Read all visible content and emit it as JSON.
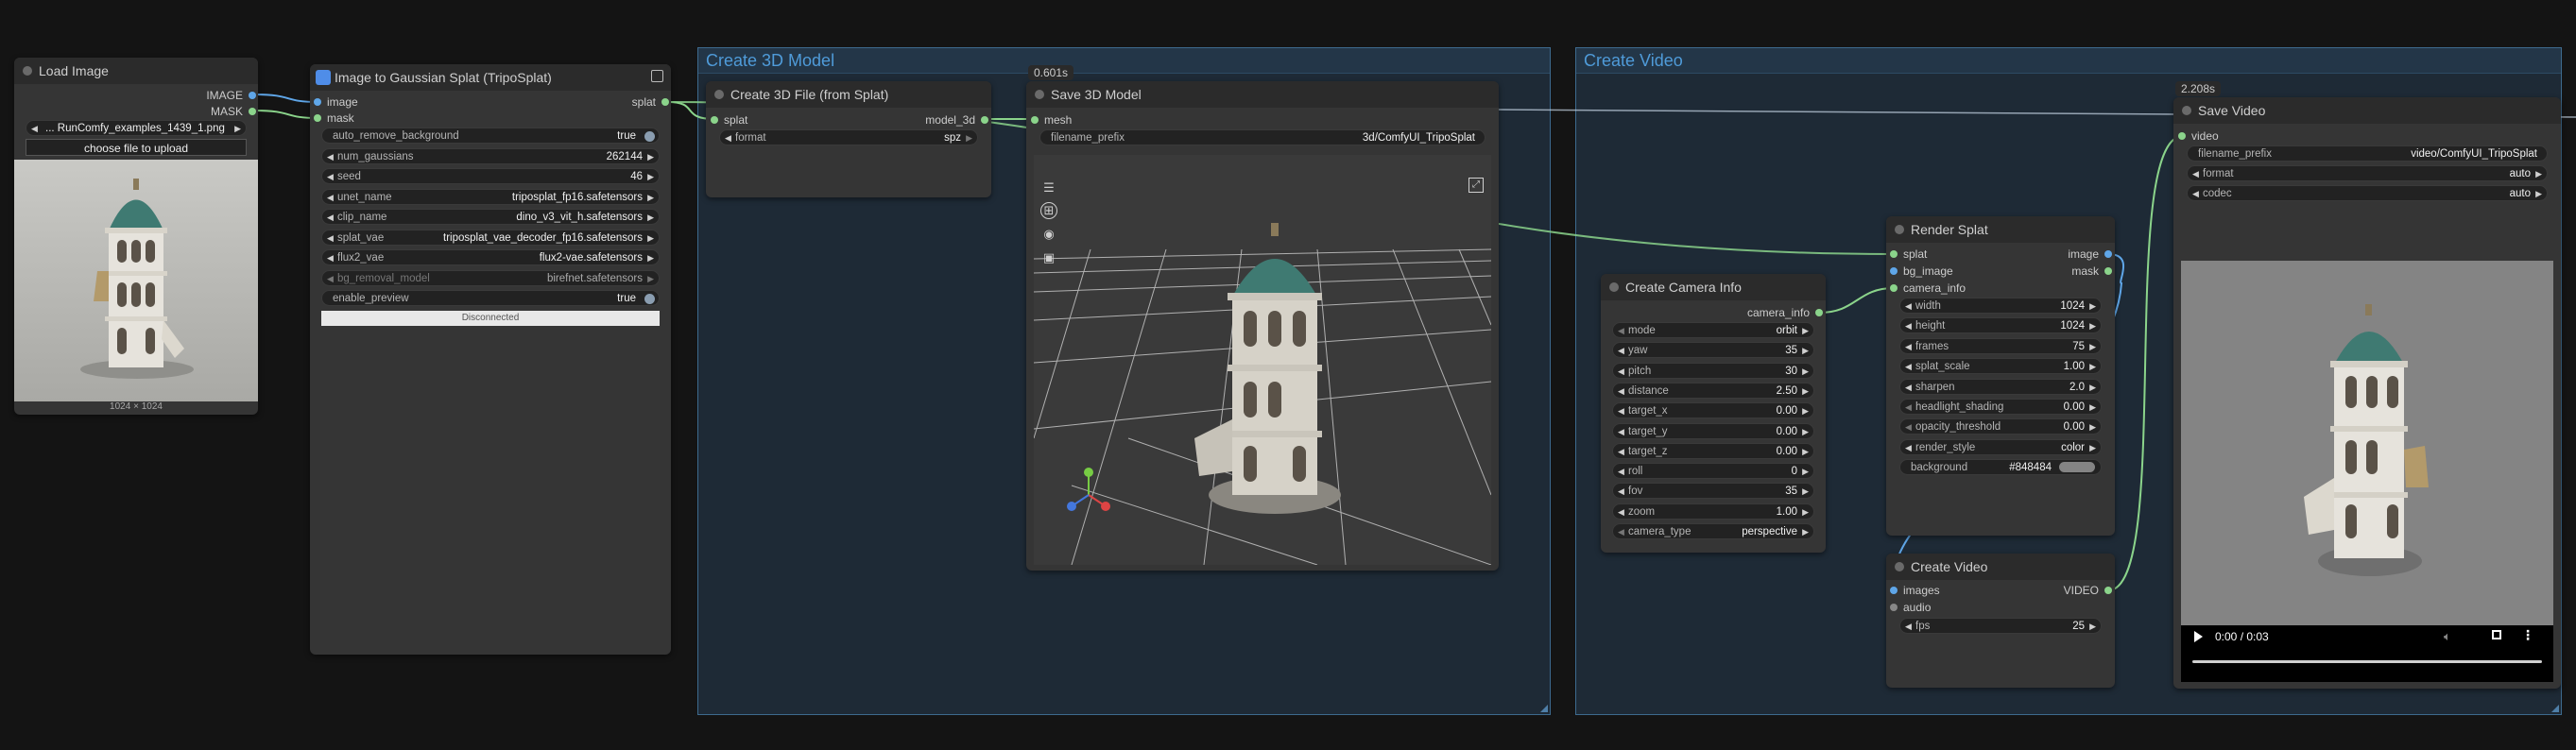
{
  "groups": {
    "create_3d_model": "Create 3D Model",
    "create_video": "Create Video"
  },
  "badges": {
    "save_3d_time": "0.601s",
    "save_video_time": "2.208s"
  },
  "load_image": {
    "title": "Load Image",
    "outputs": [
      "IMAGE",
      "MASK"
    ],
    "image_file": "... RunComfy_examples_1439_1.png",
    "upload_button": "choose file to upload",
    "preview_size": "1024 × 1024"
  },
  "tripo": {
    "title": "Image to Gaussian Splat (TripoSplat)",
    "inputs": [
      "image",
      "mask"
    ],
    "output": "splat",
    "widgets": [
      {
        "label": "auto_remove_background",
        "value": "true"
      },
      {
        "label": "num_gaussians",
        "value": "262144"
      },
      {
        "label": "seed",
        "value": "46"
      },
      {
        "label": "unet_name",
        "value": "triposplat_fp16.safetensors"
      },
      {
        "label": "clip_name",
        "value": "dino_v3_vit_h.safetensors"
      },
      {
        "label": "splat_vae",
        "value": "triposplat_vae_decoder_fp16.safetensors"
      },
      {
        "label": "flux2_vae",
        "value": "flux2-vae.safetensors"
      },
      {
        "label": "bg_removal_model",
        "value": "birefnet.safetensors"
      },
      {
        "label": "enable_preview",
        "value": "true"
      }
    ],
    "status": "Disconnected"
  },
  "create_3d_file": {
    "title": "Create 3D File (from Splat)",
    "input": "splat",
    "output": "model_3d",
    "format_label": "format",
    "format_value": "spz"
  },
  "save_3d": {
    "title": "Save 3D Model",
    "input": "mesh",
    "prefix_label": "filename_prefix",
    "prefix_value": "3d/ComfyUI_TripoSplat"
  },
  "camera": {
    "title": "Create Camera Info",
    "output": "camera_info",
    "widgets": [
      {
        "label": "mode",
        "value": "orbit"
      },
      {
        "label": "yaw",
        "value": "35"
      },
      {
        "label": "pitch",
        "value": "30"
      },
      {
        "label": "distance",
        "value": "2.50"
      },
      {
        "label": "target_x",
        "value": "0.00"
      },
      {
        "label": "target_y",
        "value": "0.00"
      },
      {
        "label": "target_z",
        "value": "0.00"
      },
      {
        "label": "roll",
        "value": "0"
      },
      {
        "label": "fov",
        "value": "35"
      },
      {
        "label": "zoom",
        "value": "1.00"
      },
      {
        "label": "camera_type",
        "value": "perspective"
      }
    ]
  },
  "render": {
    "title": "Render Splat",
    "inputs": [
      "splat",
      "bg_image",
      "camera_info"
    ],
    "outputs": [
      "image",
      "mask"
    ],
    "widgets": [
      {
        "label": "width",
        "value": "1024"
      },
      {
        "label": "height",
        "value": "1024"
      },
      {
        "label": "frames",
        "value": "75"
      },
      {
        "label": "splat_scale",
        "value": "1.00"
      },
      {
        "label": "sharpen",
        "value": "2.0"
      },
      {
        "label": "headlight_shading",
        "value": "0.00"
      },
      {
        "label": "opacity_threshold",
        "value": "0.00"
      },
      {
        "label": "render_style",
        "value": "color"
      }
    ],
    "background_label": "background",
    "background_value": "#848484",
    "background_color": "#848484"
  },
  "create_video": {
    "title": "Create Video",
    "inputs": [
      "images",
      "audio"
    ],
    "output": "VIDEO",
    "fps_label": "fps",
    "fps_value": "25"
  },
  "save_video": {
    "title": "Save Video",
    "input": "video",
    "widgets": [
      {
        "label": "filename_prefix",
        "value": "video/ComfyUI_TripoSplat"
      },
      {
        "label": "format",
        "value": "auto"
      },
      {
        "label": "codec",
        "value": "auto"
      }
    ],
    "player_time": "0:00 / 0:03"
  },
  "colors": {
    "canvas": "#141414",
    "node": "#353535",
    "group": "#1e2a36",
    "group_title": "#4f9bd9",
    "link_green": "#8bd48b",
    "link_blue": "#5fa6e8",
    "tower_dome": "#3f7a72"
  },
  "icons": [
    "menu-icon",
    "grid-icon",
    "camera-orbit-icon",
    "image-icon",
    "expand-icon",
    "play-icon",
    "mute-icon",
    "fullscreen-icon",
    "more-options-icon",
    "tripo-logo-icon",
    "toggle-icon"
  ]
}
